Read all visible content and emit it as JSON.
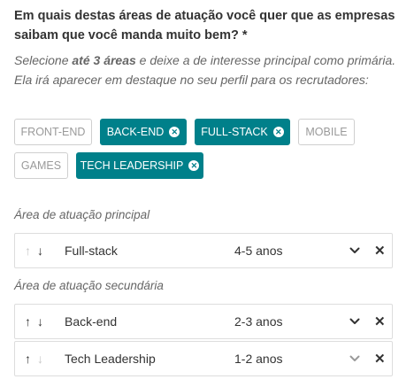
{
  "question": "Em quais destas áreas de atuação você quer que as empresas saibam que você manda muito bem? *",
  "hint": {
    "before": "Selecione ",
    "bold": "até 3 áreas",
    "after": " e deixe a de interesse principal como primária. Ela irá aparecer em destaque no seu perfil para os recrutadores:"
  },
  "tags": [
    {
      "label": "FRONT-END",
      "selected": false
    },
    {
      "label": "BACK-END",
      "selected": true
    },
    {
      "label": "FULL-STACK",
      "selected": true
    },
    {
      "label": "MOBILE",
      "selected": false
    },
    {
      "label": "GAMES",
      "selected": false
    },
    {
      "label": "TECH LEADERSHIP",
      "selected": true
    }
  ],
  "primary_label": "Área de atuação principal",
  "secondary_label": "Área de atuação secundária",
  "primary_rows": [
    {
      "area": "Full-stack",
      "years": "4-5 anos"
    }
  ],
  "secondary_rows": [
    {
      "area": "Back-end",
      "years": "2-3 anos"
    },
    {
      "area": "Tech Leadership",
      "years": "1-2 anos"
    }
  ],
  "icons": {
    "up": "arrow-up-icon",
    "down": "arrow-down-icon",
    "chevron": "chevron-down-icon",
    "remove": "close-icon",
    "tag_remove": "remove-circle-icon"
  },
  "colors": {
    "selected_tag": "#00808a",
    "text": "#333333",
    "muted": "#666666",
    "border": "#dddddd"
  }
}
